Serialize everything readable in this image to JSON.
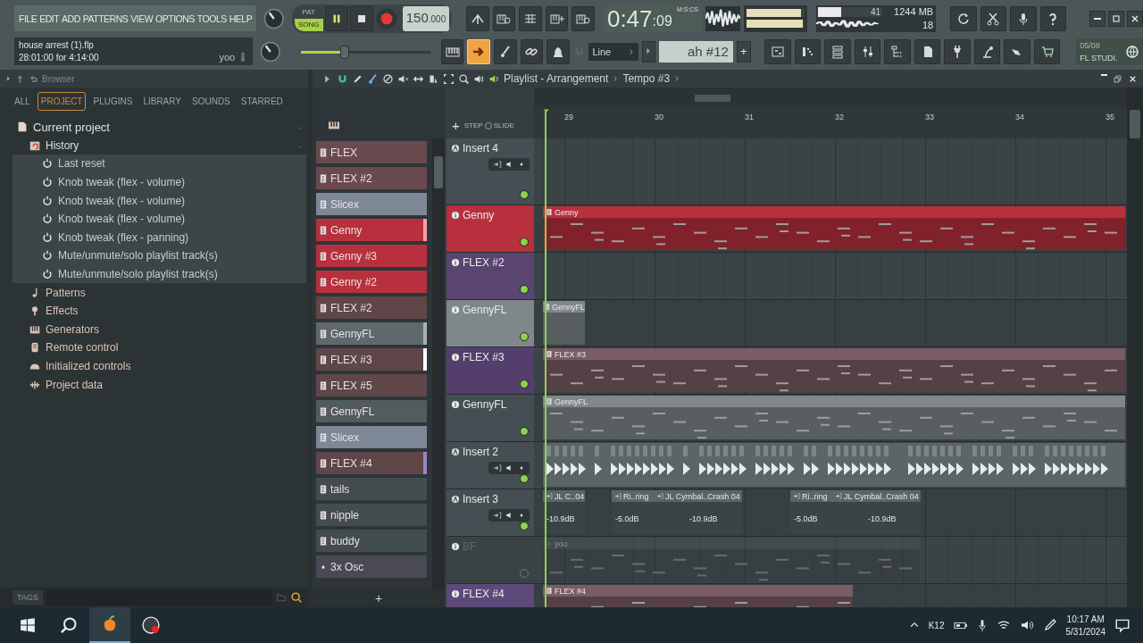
{
  "menu": [
    "FILE",
    "EDIT",
    "ADD",
    "PATTERNS",
    "VIEW",
    "OPTIONS",
    "TOOLS",
    "HELP"
  ],
  "transport": {
    "modes": [
      {
        "label": "PAT",
        "selected": false
      },
      {
        "label": "SONG",
        "selected": true
      }
    ],
    "playing": true,
    "tempo": "150",
    "tempo_fraction": ".000"
  },
  "time": {
    "value": "0:47",
    "fraction": ":09",
    "unit": "M:S:CS"
  },
  "meters": [
    {
      "level": 0.93
    },
    {
      "level": 0.97
    }
  ],
  "cpu": {
    "level": 0.36,
    "polyphony": "41",
    "memory": "1244 MB",
    "voices": "18"
  },
  "hint": {
    "file": "house arrest (1).flp",
    "info": "28:01:00 for 4:14:00",
    "user": "yoo"
  },
  "master_volume": {
    "level": 0.34
  },
  "tool_toggles": [
    {
      "on": false
    },
    {
      "on": true
    },
    {
      "on": false
    },
    {
      "on": false
    },
    {
      "on": false
    }
  ],
  "snap": {
    "value": "Line"
  },
  "pattern_selector": {
    "value": "ah #12",
    "add": "+"
  },
  "news": {
    "date": "05/08",
    "title": "FL STUDI."
  },
  "browser": {
    "title": "Browser",
    "tabs": [
      {
        "label": "ALL",
        "selected": false
      },
      {
        "label": "PROJECT",
        "selected": true
      },
      {
        "label": "PLUGINS",
        "selected": false
      },
      {
        "label": "LIBRARY",
        "selected": false
      },
      {
        "label": "SOUNDS",
        "selected": false
      },
      {
        "label": "STARRED",
        "selected": false
      }
    ],
    "tree": [
      {
        "label": "Current project",
        "kind": "project",
        "expanded": true,
        "children": [
          {
            "label": "History",
            "kind": "history",
            "expanded": true,
            "children": [
              {
                "label": "Last reset",
                "kind": "action"
              },
              {
                "label": "Knob tweak (flex - volume)",
                "kind": "action"
              },
              {
                "label": "Knob tweak (flex - volume)",
                "kind": "action"
              },
              {
                "label": "Knob tweak (flex - volume)",
                "kind": "action"
              },
              {
                "label": "Knob tweak (flex - panning)",
                "kind": "action"
              },
              {
                "label": "Mute/unmute/solo playlist track(s)",
                "kind": "action"
              },
              {
                "label": "Mute/unmute/solo playlist track(s)",
                "kind": "action"
              }
            ]
          },
          {
            "label": "Patterns",
            "kind": "patterns"
          },
          {
            "label": "Effects",
            "kind": "effects"
          },
          {
            "label": "Generators",
            "kind": "generators"
          },
          {
            "label": "Remote control",
            "kind": "remote"
          },
          {
            "label": "Initialized controls",
            "kind": "controls"
          },
          {
            "label": "Project data",
            "kind": "data"
          }
        ]
      }
    ],
    "tags_label": "TAGS"
  },
  "playlist": {
    "title": "Playlist - Arrangement",
    "breadcrumb": "Tempo #3",
    "add_track": "+",
    "step_label": "STEP",
    "slide_label": "SLIDE",
    "slide_toggle": {
      "on": false
    },
    "add_pattern": "+",
    "ruler": [
      "29",
      "30",
      "31",
      "32",
      "33",
      "34",
      "35"
    ],
    "patterns": [
      {
        "name": "FLEX",
        "kind": "pattern",
        "color": "#6a4a4f"
      },
      {
        "name": "FLEX #2",
        "kind": "pattern",
        "color": "#6a4a4f"
      },
      {
        "name": "Slicex",
        "kind": "pattern",
        "color": "#7d8896"
      },
      {
        "name": "Genny",
        "kind": "pattern",
        "color": "#b8303d",
        "marker": {
          "color": "#f2a0a6"
        }
      },
      {
        "name": "Genny #3",
        "kind": "pattern",
        "color": "#b8303d"
      },
      {
        "name": "Genny #2",
        "kind": "pattern",
        "color": "#b8303d"
      },
      {
        "name": "FLEX #2",
        "kind": "pattern",
        "color": "#5e4649"
      },
      {
        "name": "GennyFL",
        "kind": "pattern",
        "color": "#5f686b",
        "marker": {
          "color": "#a8b0b2"
        }
      },
      {
        "name": "FLEX #3",
        "kind": "pattern",
        "color": "#5e4649",
        "marker": {
          "color": "#ffffff"
        }
      },
      {
        "name": "FLEX #5",
        "kind": "pattern",
        "color": "#5e4649"
      },
      {
        "name": "GennyFL",
        "kind": "pattern",
        "color": "#525b5e"
      },
      {
        "name": "Slicex",
        "kind": "pattern",
        "color": "#7d8896"
      },
      {
        "name": "FLEX #4",
        "kind": "pattern",
        "color": "#5e4649",
        "marker": {
          "color": "#9d85c9"
        }
      },
      {
        "name": "tails",
        "kind": "pattern",
        "color": "#434c4f"
      },
      {
        "name": "nipple",
        "kind": "pattern",
        "color": "#434c4f"
      },
      {
        "name": "buddy",
        "kind": "pattern",
        "color": "#434c4f"
      },
      {
        "name": "3x Osc",
        "kind": "generator",
        "color": "#4a4a56"
      }
    ],
    "tracks": [
      {
        "name": "Insert 4",
        "kind": "insert",
        "color": "#454e52",
        "muted": false
      },
      {
        "name": "Genny",
        "kind": "instrument",
        "color": "#b8303d",
        "muted": false,
        "clips": [
          {
            "label": "Genny",
            "kind": "pattern",
            "color": "#b8303d",
            "muted": false
          }
        ]
      },
      {
        "name": "FLEX #2",
        "kind": "instrument",
        "color": "#5a4570",
        "muted": false
      },
      {
        "name": "GennyFL",
        "kind": "instrument",
        "color": "#7f8789",
        "muted": false,
        "clips": [
          {
            "label": "GennyFL",
            "kind": "pattern",
            "color": "#7f8789",
            "muted": false
          }
        ]
      },
      {
        "name": "FLEX #3",
        "kind": "instrument",
        "color": "#543f6c",
        "muted": false,
        "clips": [
          {
            "label": "FLEX #3",
            "kind": "pattern",
            "color": "#7a5c64",
            "muted": false
          }
        ]
      },
      {
        "name": "GennyFL",
        "kind": "instrument",
        "color": "#454e52",
        "muted": false,
        "clips": [
          {
            "label": "GennyFL",
            "kind": "pattern",
            "color": "#7f8789",
            "muted": false
          }
        ]
      },
      {
        "name": "Insert 2",
        "kind": "insert",
        "color": "#454e52",
        "muted": false,
        "clips": [
          {
            "kind": "audio",
            "color": "#5b6467",
            "muted": false
          }
        ]
      },
      {
        "name": "Insert 3",
        "kind": "insert",
        "color": "#454e52",
        "muted": false,
        "clips": [
          {
            "label": "JL C..04",
            "gain": "-10.9dB",
            "kind": "audio",
            "color": "#5b6467",
            "muted": false
          },
          {
            "label": "Ri..ring",
            "gain": "-5.0dB",
            "kind": "audio",
            "color": "#5b6467",
            "muted": false
          },
          {
            "label": "JL Cymbal..Crash 04",
            "gain": "-10.9dB",
            "kind": "audio",
            "color": "#5b6467",
            "muted": false
          },
          {
            "label": "Ri..ring",
            "gain": "-5.0dB",
            "kind": "audio",
            "color": "#5b6467",
            "muted": false
          },
          {
            "label": "JL Cymbal..Crash 04",
            "gain": "-10.9dB",
            "kind": "audio",
            "color": "#5b6467",
            "muted": false
          }
        ]
      },
      {
        "name": "BF",
        "kind": "instrument",
        "color": "#3a4245",
        "muted": true,
        "clips": [
          {
            "label": "yoo",
            "kind": "pattern",
            "color": "#4a5356",
            "muted": true
          }
        ]
      },
      {
        "name": "FLEX #4",
        "kind": "instrument",
        "color": "#5e4a7a",
        "muted": false,
        "clips": [
          {
            "label": "FLEX #4",
            "kind": "pattern",
            "color": "#7a5c64",
            "muted": false
          }
        ]
      }
    ]
  },
  "taskbar": {
    "tray_label": "K12",
    "time": "10:17 AM",
    "date": "5/31/2024"
  }
}
